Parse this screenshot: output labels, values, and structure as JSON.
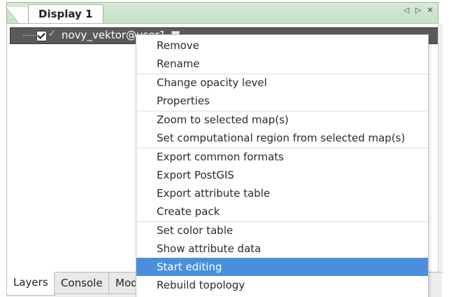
{
  "display_tab": {
    "label": "Display 1",
    "controls": [
      "◁",
      "▷",
      "✕"
    ]
  },
  "layer": {
    "name": "novy_vektor@user1",
    "checked": true
  },
  "context_menu": {
    "groups": [
      [
        "Remove",
        "Rename"
      ],
      [
        "Change opacity level",
        "Properties"
      ],
      [
        "Zoom to selected map(s)",
        "Set computational region from selected map(s)"
      ],
      [
        "Export common formats",
        "Export PostGIS",
        "Export attribute table",
        "Create pack"
      ],
      [
        "Set color table",
        "Show attribute data",
        "Start editing",
        "Rebuild topology"
      ]
    ],
    "highlighted": "Start editing"
  },
  "bottom_tabs": [
    "Layers",
    "Console",
    "Mod"
  ],
  "active_bottom_tab": "Layers",
  "colors": {
    "menu_highlight": "#4a8fdc",
    "tabstrip": "#d6ead6",
    "layer_row": "#5a5a5a"
  }
}
